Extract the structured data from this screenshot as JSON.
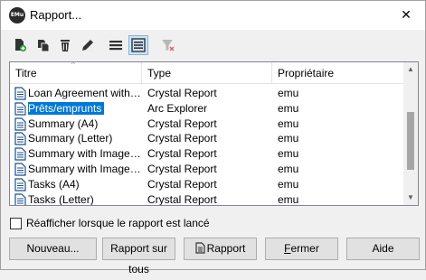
{
  "window": {
    "title": "Rapport...",
    "app_icon_text": "EMu",
    "close_glyph": "✕"
  },
  "toolbar": {
    "icons": [
      "new-document-icon",
      "copy-icon",
      "delete-icon",
      "edit-icon",
      "list-view-icon",
      "details-view-icon",
      "filter-clear-icon"
    ],
    "active": "details-view-icon"
  },
  "table": {
    "columns": [
      "Titre",
      "Type",
      "Propriétaire"
    ],
    "sort_glyph": "^",
    "rows": [
      {
        "title": "Loan Agreement with I...",
        "type": "Crystal Report",
        "owner": "emu",
        "selected": false
      },
      {
        "title": "Prêts/emprunts",
        "type": "Arc Explorer",
        "owner": "emu",
        "selected": true
      },
      {
        "title": "Summary (A4)",
        "type": "Crystal Report",
        "owner": "emu",
        "selected": false
      },
      {
        "title": "Summary (Letter)",
        "type": "Crystal Report",
        "owner": "emu",
        "selected": false
      },
      {
        "title": "Summary with Images ...",
        "type": "Crystal Report",
        "owner": "emu",
        "selected": false
      },
      {
        "title": "Summary with Images ...",
        "type": "Crystal Report",
        "owner": "emu",
        "selected": false
      },
      {
        "title": "Tasks (A4)",
        "type": "Crystal Report",
        "owner": "emu",
        "selected": false
      },
      {
        "title": "Tasks (Letter)",
        "type": "Crystal Report",
        "owner": "emu",
        "selected": false
      }
    ]
  },
  "scrollbar": {
    "up_glyph": "▲",
    "down_glyph": "▼"
  },
  "checkbox": {
    "label": "Réafficher lorsque le rapport est lancé",
    "checked": false
  },
  "buttons": {
    "new": "Nouveau...",
    "report_all": "Rapport sur tous",
    "report": "Rapport",
    "close_pre": "",
    "close_u": "F",
    "close_post": "ermer",
    "help": "Aide"
  }
}
